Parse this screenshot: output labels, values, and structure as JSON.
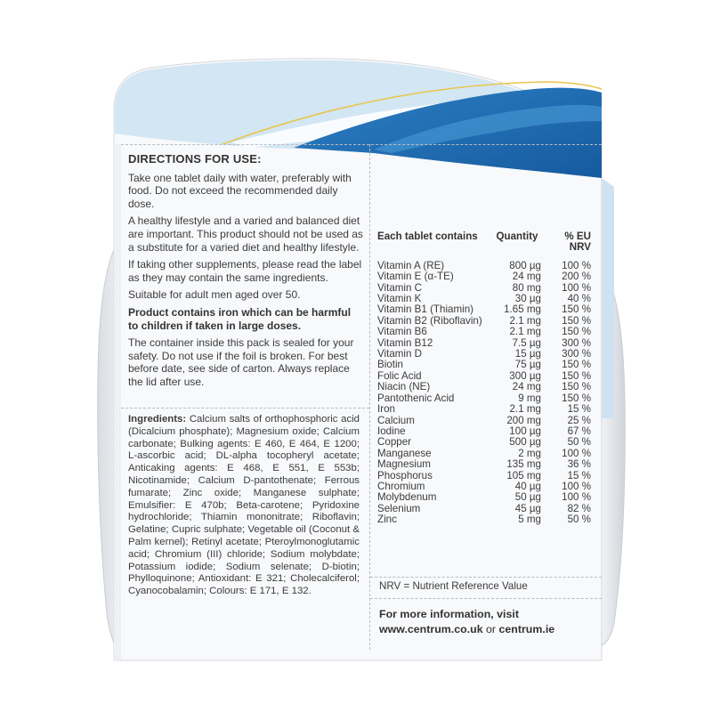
{
  "colors": {
    "background": "#ffffff",
    "carton": "#f7f8fa",
    "accent_blue": "#1f6fb8",
    "light_blue": "#cfe3f1",
    "text": "#3c3c3c"
  },
  "directions": {
    "heading": "DIRECTIONS FOR USE:",
    "paragraphs": [
      "Take one tablet daily with water, preferably with food. Do not exceed the recommended daily dose.",
      "A healthy lifestyle and a varied and balanced diet are important. This product should not be used as a substitute for a varied diet and healthy lifestyle.",
      "If taking other supplements, please read the label as they may contain the same ingredients.",
      "Suitable for adult men aged over 50."
    ],
    "warning": "Product contains iron which can be harmful to children if taken in large doses.",
    "seal_note": "The container inside this pack is sealed for your safety. Do not use if the foil is broken. For best before date, see side of carton. Always replace the lid after use."
  },
  "ingredients": {
    "label": "Ingredients:",
    "text": " Calcium salts of orthophosphoric acid (Dicalcium phosphate); Magnesium oxide; Calcium carbonate; Bulking agents: E 460, E 464, E 1200; L-ascorbic acid; DL-alpha tocopheryl acetate; Anticaking agents: E 468, E 551, E 553b; Nicotinamide; Calcium D-pantothenate; Ferrous fumarate; Zinc oxide; Manganese sulphate; Emulsifier: E 470b; Beta-carotene; Pyridoxine hydrochloride; Thiamin mononitrate; Riboflavin; Gelatine; Cupric sulphate; Vegetable oil (Coconut & Palm kernel); Retinyl acetate; Pteroylmonoglutamic acid; Chromium (III) chloride; Sodium molybdate; Potassium iodide; Sodium selenate; D-biotin; Phylloquinone; Antioxidant: E 321; Cholecalciferol; Cyanocobalamin; Colours: E 171, E 132."
  },
  "nutrition": {
    "headers": {
      "name": "Each tablet contains",
      "quantity": "Quantity",
      "nrv_line1": "% EU",
      "nrv_line2": "NRV"
    },
    "rows": [
      {
        "name": "Vitamin A (RE)",
        "qty": "800 µg",
        "nrv": "100 %"
      },
      {
        "name": "Vitamin E (α-TE)",
        "qty": "24 mg",
        "nrv": "200 %"
      },
      {
        "name": "Vitamin C",
        "qty": "80 mg",
        "nrv": "100 %"
      },
      {
        "name": "Vitamin K",
        "qty": "30 µg",
        "nrv": "40 %"
      },
      {
        "name": "Vitamin B1 (Thiamin)",
        "qty": "1.65 mg",
        "nrv": "150 %"
      },
      {
        "name": "Vitamin B2 (Riboflavin)",
        "qty": "2.1 mg",
        "nrv": "150 %"
      },
      {
        "name": "Vitamin B6",
        "qty": "2.1 mg",
        "nrv": "150 %"
      },
      {
        "name": "Vitamin B12",
        "qty": "7.5 µg",
        "nrv": "300 %"
      },
      {
        "name": "Vitamin D",
        "qty": "15 µg",
        "nrv": "300 %"
      },
      {
        "name": "Biotin",
        "qty": "75 µg",
        "nrv": "150 %"
      },
      {
        "name": "Folic Acid",
        "qty": "300 µg",
        "nrv": "150 %"
      },
      {
        "name": "Niacin (NE)",
        "qty": "24 mg",
        "nrv": "150 %"
      },
      {
        "name": "Pantothenic Acid",
        "qty": "9 mg",
        "nrv": "150 %"
      },
      {
        "name": "Iron",
        "qty": "2.1 mg",
        "nrv": "15 %"
      },
      {
        "name": "Calcium",
        "qty": "200 mg",
        "nrv": "25 %"
      },
      {
        "name": "Iodine",
        "qty": "100 µg",
        "nrv": "67 %"
      },
      {
        "name": "Copper",
        "qty": "500 µg",
        "nrv": "50 %"
      },
      {
        "name": "Manganese",
        "qty": "2 mg",
        "nrv": "100 %"
      },
      {
        "name": "Magnesium",
        "qty": "135 mg",
        "nrv": "36 %"
      },
      {
        "name": "Phosphorus",
        "qty": "105 mg",
        "nrv": "15 %"
      },
      {
        "name": "Chromium",
        "qty": "40 µg",
        "nrv": "100 %"
      },
      {
        "name": "Molybdenum",
        "qty": "50 µg",
        "nrv": "100 %"
      },
      {
        "name": "Selenium",
        "qty": "45 µg",
        "nrv": "82 %"
      },
      {
        "name": "Zinc",
        "qty": "5 mg",
        "nrv": "50 %"
      }
    ],
    "footnote": "NRV = Nutrient Reference Value"
  },
  "more_info": {
    "line1": "For more information, visit",
    "url_uk": "www.centrum.co.uk",
    "or": " or ",
    "url_ie": "centrum.ie"
  }
}
